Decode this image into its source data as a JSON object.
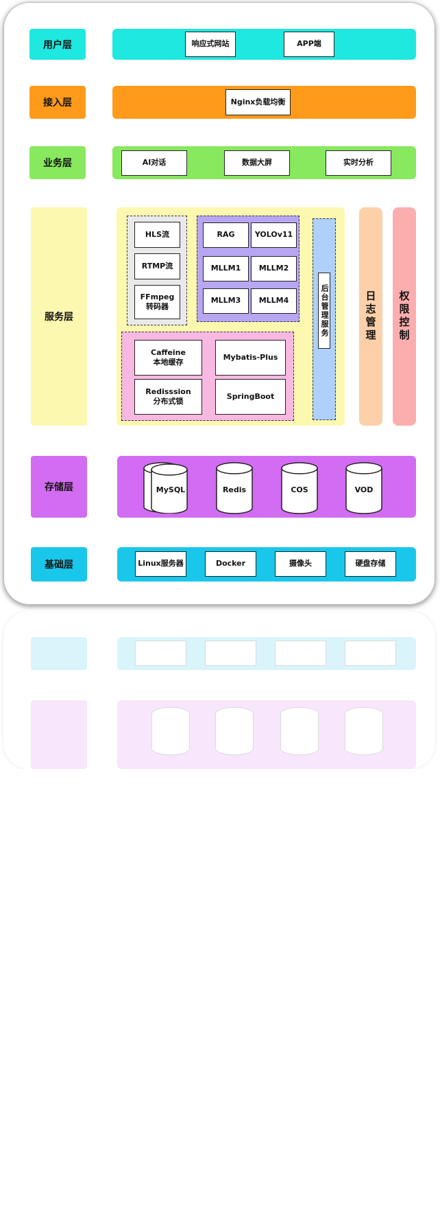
{
  "layers": {
    "user": {
      "label": "用户层",
      "items": [
        "响应式网站",
        "APP端"
      ]
    },
    "access": {
      "label": "接入层",
      "items": [
        "Nginx负载均衡"
      ]
    },
    "business": {
      "label": "业务层",
      "items": [
        "AI对话",
        "数据大屏",
        "实时分析"
      ]
    },
    "service": {
      "label": "服务层",
      "media": [
        "HLS流",
        "RTMP流",
        "FFmpeg\n转码器"
      ],
      "ai": [
        "RAG",
        "YOLOv11",
        "MLLM1",
        "MLLM2",
        "MLLM3",
        "MLLM4"
      ],
      "infra": [
        "Caffeine\n本地缓存",
        "Mybatis-Plus",
        "Redisssion\n分布式锁",
        "SpringBoot"
      ],
      "admin": "后台管理服务",
      "log": "日志管理",
      "auth": "权限控制"
    },
    "storage": {
      "label": "存储层",
      "items": [
        "MySQL",
        "Redis",
        "COS",
        "VOD"
      ]
    },
    "base": {
      "label": "基础层",
      "items": [
        "Linux服务器",
        "Docker",
        "摄像头",
        "硬盘存储"
      ]
    }
  },
  "colors": {
    "user": "#1ee8df",
    "access": "#ff9a1a",
    "business": "#88e85e",
    "service": "#fdf8b0",
    "media": "#e9e9e9",
    "ai": "#b7a6f2",
    "infra": "#f7b8e1",
    "admin": "#aed0fb",
    "log": "#fdd0aa",
    "auth": "#fcaeae",
    "storage": "#d26cf2",
    "base": "#19c7ea"
  }
}
